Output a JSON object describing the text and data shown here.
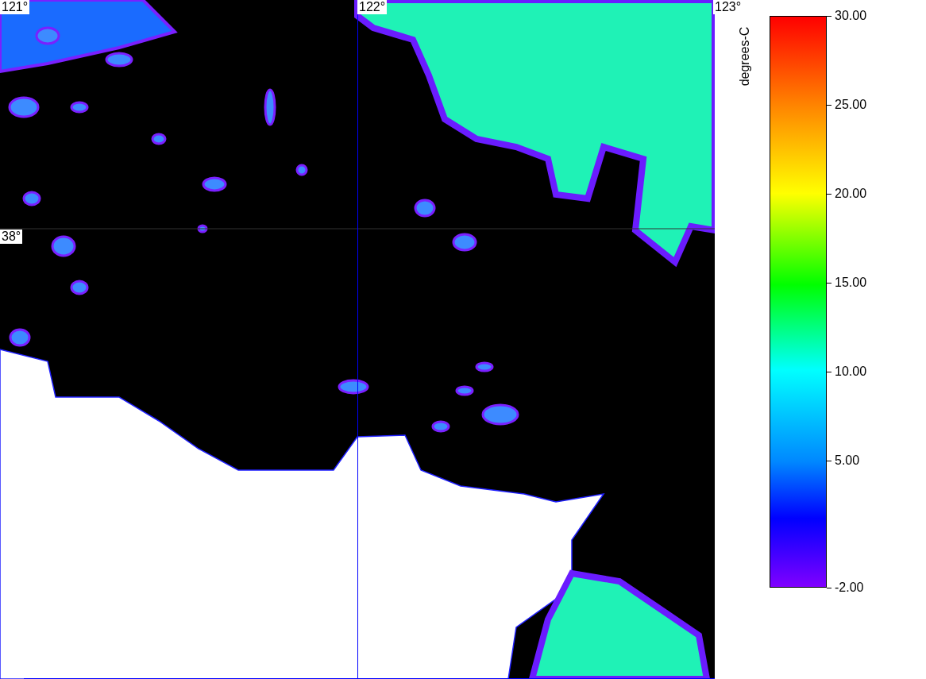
{
  "map": {
    "grid_labels": [
      {
        "text": "121°",
        "kind": "longitude"
      },
      {
        "text": "122°",
        "kind": "longitude"
      },
      {
        "text": "123°",
        "kind": "longitude"
      },
      {
        "text": "38°",
        "kind": "latitude"
      }
    ]
  },
  "colorbar": {
    "title": "degrees-C",
    "ticks": [
      "30.00",
      "25.00",
      "20.00",
      "15.00",
      "10.00",
      "5.00",
      "-2.00"
    ]
  }
}
